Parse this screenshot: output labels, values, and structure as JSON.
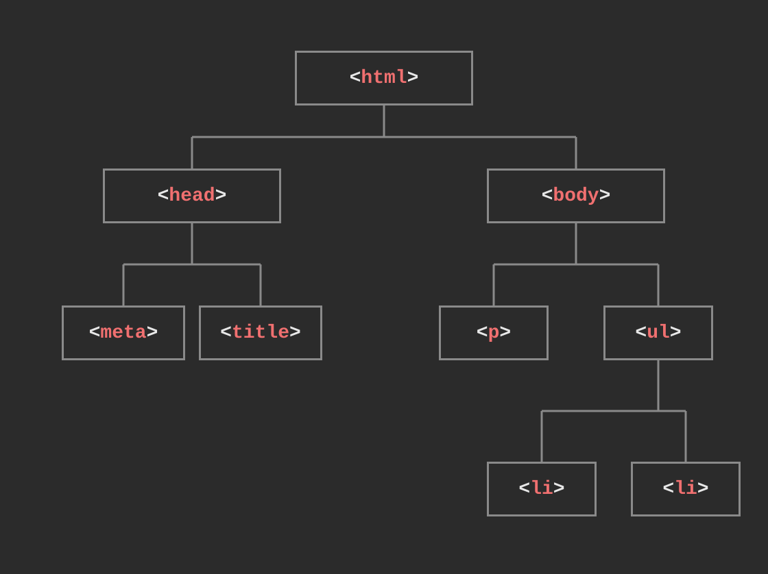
{
  "nodes": {
    "html": {
      "open": "<",
      "tag": "html",
      "close": ">"
    },
    "head": {
      "open": "<",
      "tag": "head",
      "close": ">"
    },
    "body": {
      "open": "<",
      "tag": "body",
      "close": ">"
    },
    "meta": {
      "open": "<",
      "tag": "meta",
      "close": ">"
    },
    "title": {
      "open": "<",
      "tag": "title",
      "close": ">"
    },
    "p": {
      "open": "<",
      "tag": "p",
      "close": ">"
    },
    "ul": {
      "open": "<",
      "tag": "ul",
      "close": ">"
    },
    "li1": {
      "open": "<",
      "tag": "li",
      "close": ">"
    },
    "li2": {
      "open": "<",
      "tag": "li",
      "close": ">"
    }
  },
  "tree": {
    "root": "html",
    "children": {
      "html": [
        "head",
        "body"
      ],
      "head": [
        "meta",
        "title"
      ],
      "body": [
        "p",
        "ul"
      ],
      "ul": [
        "li1",
        "li2"
      ]
    }
  },
  "colors": {
    "background": "#2b2b2b",
    "border": "#8a8a8a",
    "bracket": "#e8e8e8",
    "tag": "#f07070"
  }
}
